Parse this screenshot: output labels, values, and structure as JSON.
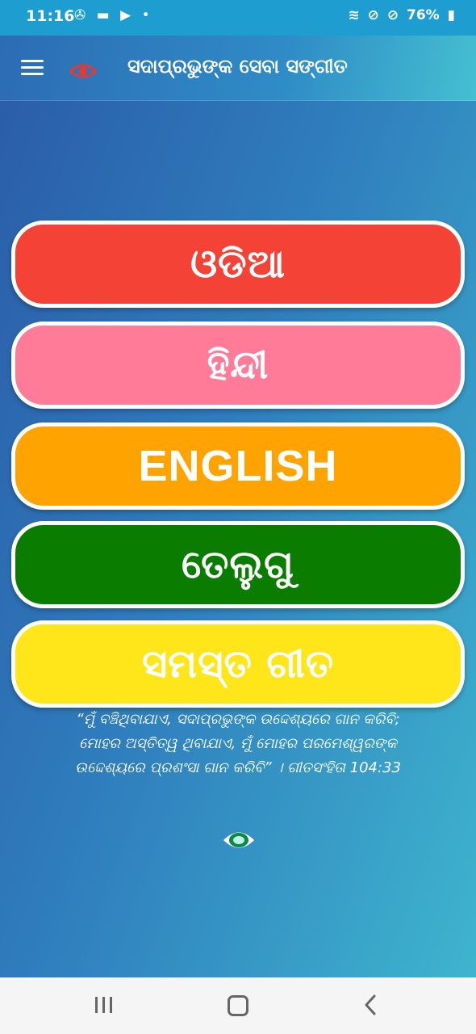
{
  "status_bar": {
    "time": "11:16",
    "battery": "76%"
  },
  "header": {
    "title": "ସଦାପ୍ରଭୁଙ୍କ ସେବା ସଙ୍ଗୀତ"
  },
  "buttons": {
    "odia": "ଓଡିଆ",
    "hindi": "ହିନ୍ଦୀ",
    "english": "ENGLISH",
    "telugu": "ତେଲୁଗୁ",
    "all": "ସମସ୍ତ ଗୀତ"
  },
  "colors": {
    "odia": "#f44336",
    "hindi": "#ff7b97",
    "english": "#ffa300",
    "telugu": "#0a7d00",
    "all": "#ffe61a"
  },
  "verse": {
    "line1": "“ମୁଁ ବଞ୍ଚିଥିବାଯାଏ, ସଦାପ୍ରଭୁଙ୍କ ଉଦ୍ଦେଶ୍ୟରେ ଗାନ କରିବି;",
    "line2": "ମୋହର ଅସ୍ତିତ୍ୱ ଥିବାଯାଏ, ମୁଁ ମୋହର ପରମେଶ୍ୱରଙ୍କ",
    "line3": "ଉଦ୍ଦେଶ୍ୟରେ ପ୍ରଶଂସା ଗାନ କରିବି” । ଗୀତସଂହିତା 104:33"
  }
}
